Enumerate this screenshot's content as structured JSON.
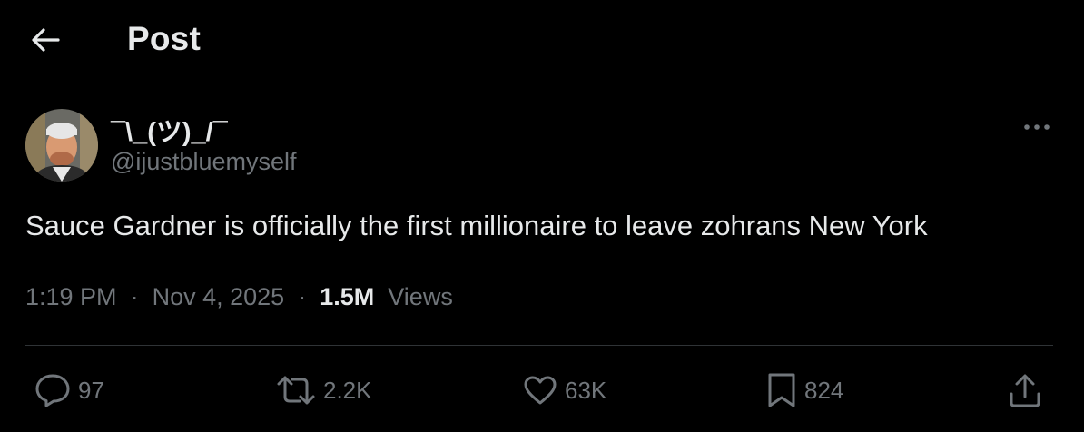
{
  "header": {
    "title": "Post",
    "back_icon": "arrow-left-icon"
  },
  "author": {
    "display_name": "¯\\_(ツ)_/¯",
    "handle": "@ijustbluemyself",
    "avatar_icon": "avatar"
  },
  "post": {
    "text": "Sauce Gardner is officially the first millionaire to leave zohrans New York",
    "time": "1:19 PM",
    "date": "Nov 4, 2025",
    "separator": "·",
    "views_count": "1.5M",
    "views_label": "Views"
  },
  "actions": {
    "replies": {
      "icon": "reply-icon",
      "count": "97"
    },
    "reposts": {
      "icon": "repost-icon",
      "count": "2.2K"
    },
    "likes": {
      "icon": "heart-icon",
      "count": "63K"
    },
    "bookmarks": {
      "icon": "bookmark-icon",
      "count": "824"
    },
    "share": {
      "icon": "share-icon"
    }
  },
  "colors": {
    "background": "#000000",
    "text": "#e7e9ea",
    "muted": "#71767b",
    "divider": "#2f3336"
  }
}
